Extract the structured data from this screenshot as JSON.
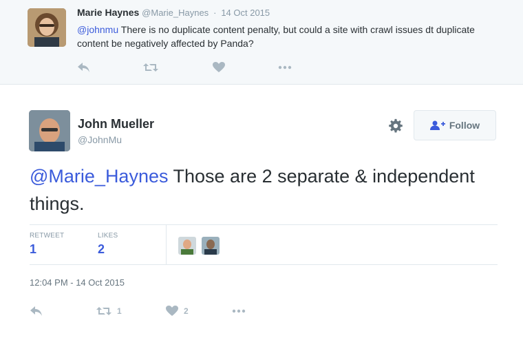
{
  "parent_tweet": {
    "name": "Marie Haynes",
    "handle": "@Marie_Haynes",
    "separator": "·",
    "date": "14 Oct 2015",
    "mention": "@johnmu",
    "text": " There is no duplicate content penalty, but could a site with crawl issues dt duplicate content be negatively affected by Panda?",
    "actions": {
      "reply_icon": "reply-icon",
      "retweet_icon": "retweet-icon",
      "like_icon": "heart-icon",
      "more_icon": "more-icon"
    }
  },
  "main_tweet": {
    "name": "John Mueller",
    "handle": "@JohnMu",
    "follow_label": "Follow",
    "mention": "@Marie_Haynes",
    "text": " Those are 2 separate & independent things.",
    "stats": {
      "retweet_label": "RETWEET",
      "retweet_count": "1",
      "likes_label": "LIKES",
      "likes_count": "2"
    },
    "timestamp": "12:04 PM - 14 Oct 2015",
    "actions": {
      "retweet_count": "1",
      "like_count": "2"
    }
  },
  "colors": {
    "accent": "#3b5bdb",
    "muted": "#8899a6",
    "icon": "#aab8c2",
    "parent_bg": "#f5f8fa"
  }
}
